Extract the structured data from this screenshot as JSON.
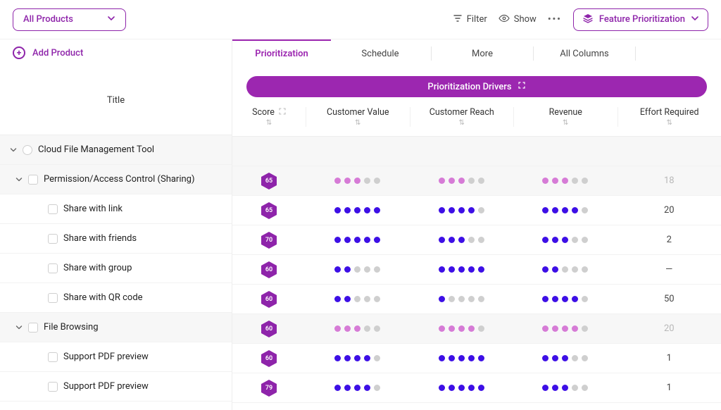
{
  "topbar": {
    "product_filter": "All Products",
    "filter_label": "Filter",
    "show_label": "Show",
    "feature_prioritization": "Feature Prioritization"
  },
  "leftcol": {
    "add_product": "Add Product",
    "title_header": "Title"
  },
  "tabs": {
    "prioritization": "Prioritization",
    "schedule": "Schedule",
    "more": "More",
    "all_columns": "All Columns"
  },
  "drivers_bar": "Prioritization Drivers",
  "columns": {
    "score": "Score",
    "customer_value": "Customer Value",
    "customer_reach": "Customer Reach",
    "revenue": "Revenue",
    "effort_required": "Effort Required"
  },
  "rows": [
    {
      "type": "root",
      "title": "Cloud File Management Tool"
    },
    {
      "type": "group",
      "title": "Permission/Access Control (Sharing)",
      "score": 65,
      "dot_color": "pink",
      "cv": 3,
      "cr": 3,
      "rev": 3,
      "effort": "18",
      "effort_muted": true
    },
    {
      "type": "item",
      "title": "Share with link",
      "score": 65,
      "dot_color": "purple",
      "cv": 5,
      "cr": 4,
      "rev": 4,
      "effort": "20"
    },
    {
      "type": "item",
      "title": "Share with friends",
      "score": 70,
      "dot_color": "purple",
      "cv": 5,
      "cr": 3,
      "rev": 3,
      "effort": "2"
    },
    {
      "type": "item",
      "title": "Share with group",
      "score": 60,
      "dot_color": "purple",
      "cv": 2,
      "cr": 5,
      "rev": 2,
      "effort": "—"
    },
    {
      "type": "item",
      "title": "Share with QR code",
      "score": 60,
      "dot_color": "purple",
      "cv": 2,
      "cr": 1,
      "rev": 4,
      "effort": "50"
    },
    {
      "type": "group",
      "title": "File Browsing",
      "score": 60,
      "dot_color": "pink",
      "cv": 3,
      "cr": 4,
      "rev": 4,
      "effort": "20",
      "effort_muted": true
    },
    {
      "type": "item",
      "title": "Support PDF preview",
      "score": 60,
      "dot_color": "purple",
      "cv": 4,
      "cr": 5,
      "rev": 3,
      "effort": "1"
    },
    {
      "type": "item",
      "title": "Support PDF preview",
      "score": 79,
      "dot_color": "purple",
      "cv": 4,
      "cr": 5,
      "rev": 3,
      "effort": "1"
    }
  ],
  "colors": {
    "hex_fill": "#8e24aa"
  }
}
